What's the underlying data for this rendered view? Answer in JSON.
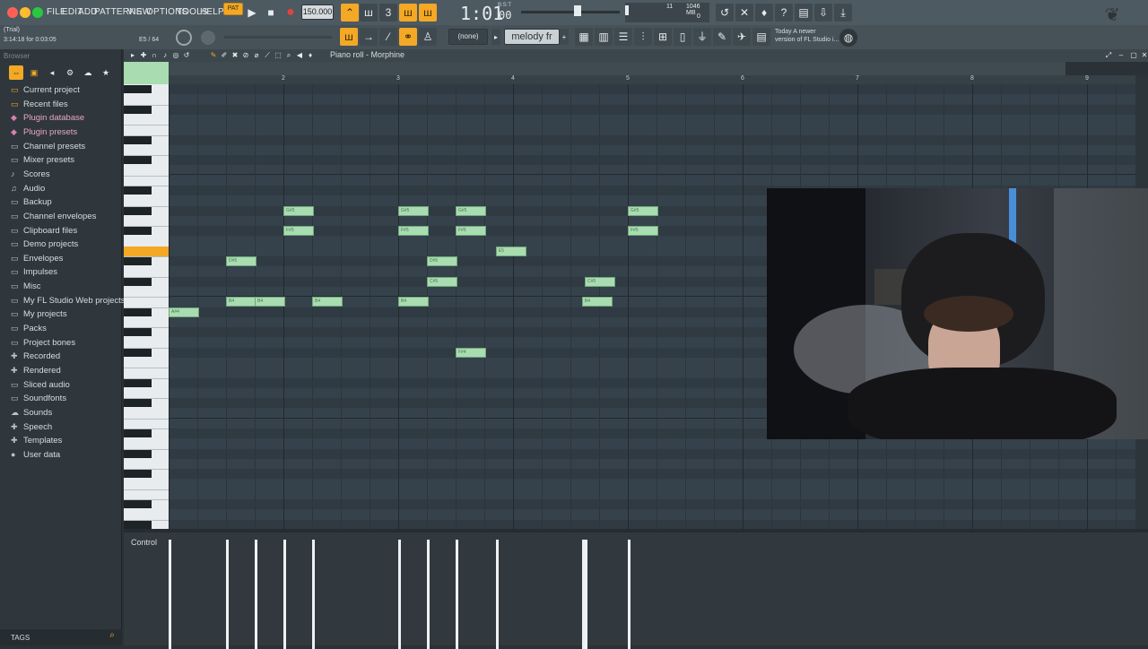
{
  "window": {
    "trial": "(Trial)",
    "position_readout": "3:14:18 for 0:03:05",
    "note_readout": "E5 / 64"
  },
  "menu": [
    "FILE",
    "EDIT",
    "ADD",
    "PATTERNS",
    "VIEW",
    "OPTIONS",
    "TOOLS",
    "HELP"
  ],
  "transport": {
    "pat_label": "PAT",
    "tempo": "150.000",
    "time": "1:01",
    "time_sub": "00",
    "bst": "B:S:T"
  },
  "meters": {
    "cpu": "11",
    "memory": "1046 MB",
    "voices": "0"
  },
  "hint": {
    "line1": "Today  A newer",
    "line2": "version of FL Studio i..."
  },
  "toolbar2": {
    "pattern_select": "(none)",
    "channel_name": "melody fr"
  },
  "browser": {
    "title": "Browser",
    "items": [
      {
        "label": "Current project",
        "icon": "folder-icon"
      },
      {
        "label": "Recent files",
        "icon": "folder-icon"
      },
      {
        "label": "Plugin database",
        "icon": "plug-icon"
      },
      {
        "label": "Plugin presets",
        "icon": "plug-icon"
      },
      {
        "label": "Channel presets",
        "icon": "folder-icon"
      },
      {
        "label": "Mixer presets",
        "icon": "folder-icon"
      },
      {
        "label": "Scores",
        "icon": "note-icon"
      },
      {
        "label": "Audio",
        "icon": "audio-icon"
      },
      {
        "label": "Backup",
        "icon": "folder-icon"
      },
      {
        "label": "Channel envelopes",
        "icon": "folder-icon"
      },
      {
        "label": "Clipboard files",
        "icon": "folder-icon"
      },
      {
        "label": "Demo projects",
        "icon": "folder-icon"
      },
      {
        "label": "Envelopes",
        "icon": "folder-icon"
      },
      {
        "label": "Impulses",
        "icon": "folder-icon"
      },
      {
        "label": "Misc",
        "icon": "folder-icon"
      },
      {
        "label": "My FL Studio Web projects",
        "icon": "folder-icon"
      },
      {
        "label": "My projects",
        "icon": "folder-icon"
      },
      {
        "label": "Packs",
        "icon": "folder-icon"
      },
      {
        "label": "Project bones",
        "icon": "folder-icon"
      },
      {
        "label": "Recorded",
        "icon": "plus-icon"
      },
      {
        "label": "Rendered",
        "icon": "plus-icon"
      },
      {
        "label": "Sliced audio",
        "icon": "folder-icon"
      },
      {
        "label": "Soundfonts",
        "icon": "folder-icon"
      },
      {
        "label": "Sounds",
        "icon": "cloud-icon"
      },
      {
        "label": "Speech",
        "icon": "plus-icon"
      },
      {
        "label": "Templates",
        "icon": "plus-icon"
      },
      {
        "label": "User data",
        "icon": "user-icon"
      }
    ],
    "tags_label": "TAGS"
  },
  "piano_roll": {
    "title": "Piano roll - Morphine",
    "bars": [
      "2",
      "3",
      "4",
      "5",
      "6",
      "7",
      "8",
      "9"
    ],
    "notes": [
      {
        "pitch": "A#4",
        "start": 1.0,
        "len": 0.5
      },
      {
        "pitch": "B4",
        "start": 1.5,
        "len": 0.5
      },
      {
        "pitch": "B4",
        "start": 1.75,
        "len": 0.5
      },
      {
        "pitch": "B4",
        "start": 2.25,
        "len": 0.5
      },
      {
        "pitch": "G#5",
        "start": 2.0,
        "len": 0.5
      },
      {
        "pitch": "F#5",
        "start": 2.0,
        "len": 0.5
      },
      {
        "pitch": "B4",
        "start": 3.0,
        "len": 0.5
      },
      {
        "pitch": "C#5",
        "start": 3.25,
        "len": 0.5
      },
      {
        "pitch": "F#4",
        "start": 3.5,
        "len": 0.5
      },
      {
        "pitch": "G#5",
        "start": 3.0,
        "len": 0.5
      },
      {
        "pitch": "F#5",
        "start": 3.0,
        "len": 0.5
      },
      {
        "pitch": "D#5",
        "start": 3.25,
        "len": 0.5
      },
      {
        "pitch": "G#5",
        "start": 3.5,
        "len": 0.5
      },
      {
        "pitch": "F#5",
        "start": 3.5,
        "len": 0.5
      },
      {
        "pitch": "E5",
        "start": 3.85,
        "len": 0.5
      },
      {
        "pitch": "C#5",
        "start": 4.625,
        "len": 0.5
      },
      {
        "pitch": "B4",
        "start": 4.6,
        "len": 0.5
      },
      {
        "pitch": "G#5",
        "start": 5.0,
        "len": 0.5
      },
      {
        "pitch": "F#5",
        "start": 5.0,
        "len": 0.5
      },
      {
        "pitch": "D#5",
        "start": 1.5,
        "len": 0.5
      }
    ]
  },
  "control": {
    "label": "Control"
  }
}
